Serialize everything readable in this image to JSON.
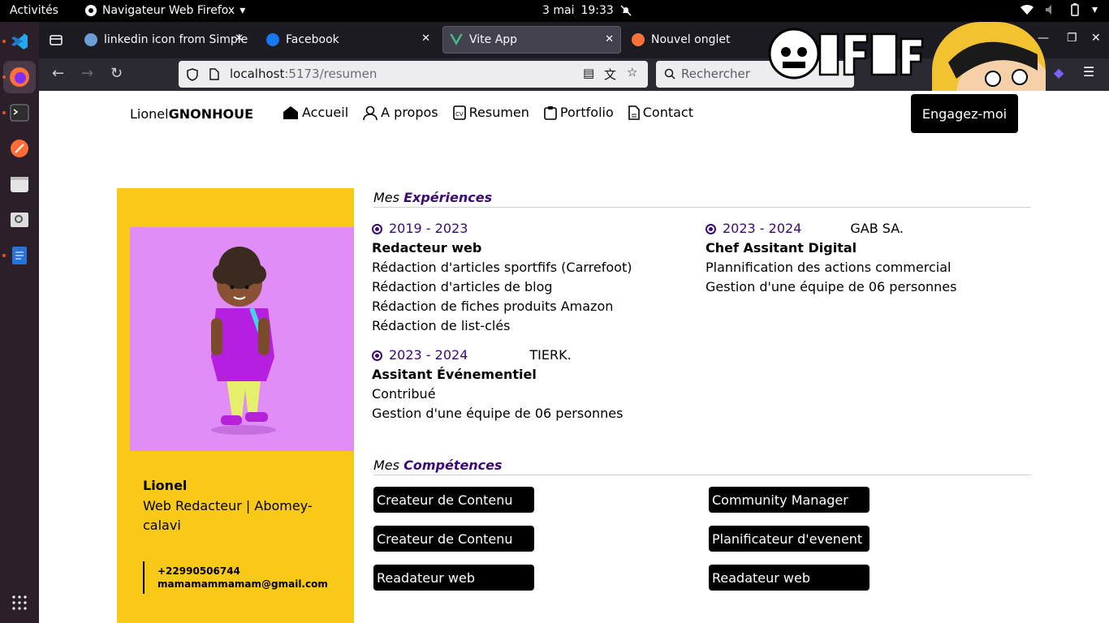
{
  "system": {
    "activities": "Activités",
    "app_name": "Navigateur Web Firefox",
    "date": "3 mai",
    "time": "19:33"
  },
  "tabs": [
    {
      "title": "linkedin icon from Simple",
      "favicon_color": "#6c9fd6"
    },
    {
      "title": "Facebook",
      "favicon_color": "#1877f2"
    },
    {
      "title": "Vite App",
      "favicon_color": "#41b883"
    },
    {
      "title": "Nouvel onglet",
      "favicon_color": "#ff7139"
    }
  ],
  "url": {
    "host": "localhost",
    "path": ":5173/resumen"
  },
  "search": {
    "placeholder": "Rechercher"
  },
  "site": {
    "logo_first": "Lionel",
    "logo_last": "GNONHOUE",
    "menu": [
      "Accueil",
      "A propos",
      "Resumen",
      "Portfolio",
      "Contact"
    ],
    "cta": "Engagez-moi"
  },
  "profile": {
    "name": "Lionel",
    "role": "Web Redacteur | Abomey-calavi",
    "phone": "+22990506744",
    "email": "mamamammamam@gmail.com"
  },
  "experiences_title": {
    "prefix": "Mes",
    "highlight": "Expériences"
  },
  "experiences": [
    {
      "years": "2019 - 2023",
      "company": "",
      "role": "Redacteur web",
      "lines": [
        "Rédaction d'articles sportfifs (Carrefoot)",
        "Rédaction d'articles de blog",
        "Rédaction de fiches produits Amazon",
        "Rédaction de list-clés"
      ]
    },
    {
      "years": "2023 - 2024",
      "company": "GAB SA.",
      "role": "Chef Assitant Digital",
      "lines": [
        "Plannification des actions commercial",
        "Gestion d'une équipe de 06 personnes"
      ]
    },
    {
      "years": "2023 - 2024",
      "company": "TIERK.",
      "role": "Assitant Événementiel",
      "lines": [
        "Contribué",
        "Gestion d'une équipe de 06 personnes"
      ]
    }
  ],
  "skills_title": {
    "prefix": "Mes",
    "highlight": "Compétences"
  },
  "skills": [
    "Createur de Contenu",
    "Community Manager",
    "Createur de Contenu",
    "Planificateur d'evenent",
    "Readateur web",
    "Readateur web"
  ],
  "colors": {
    "accent": "#3b0a74",
    "profile_bg": "#f9c917",
    "portrait_bg": "#e08df8"
  }
}
